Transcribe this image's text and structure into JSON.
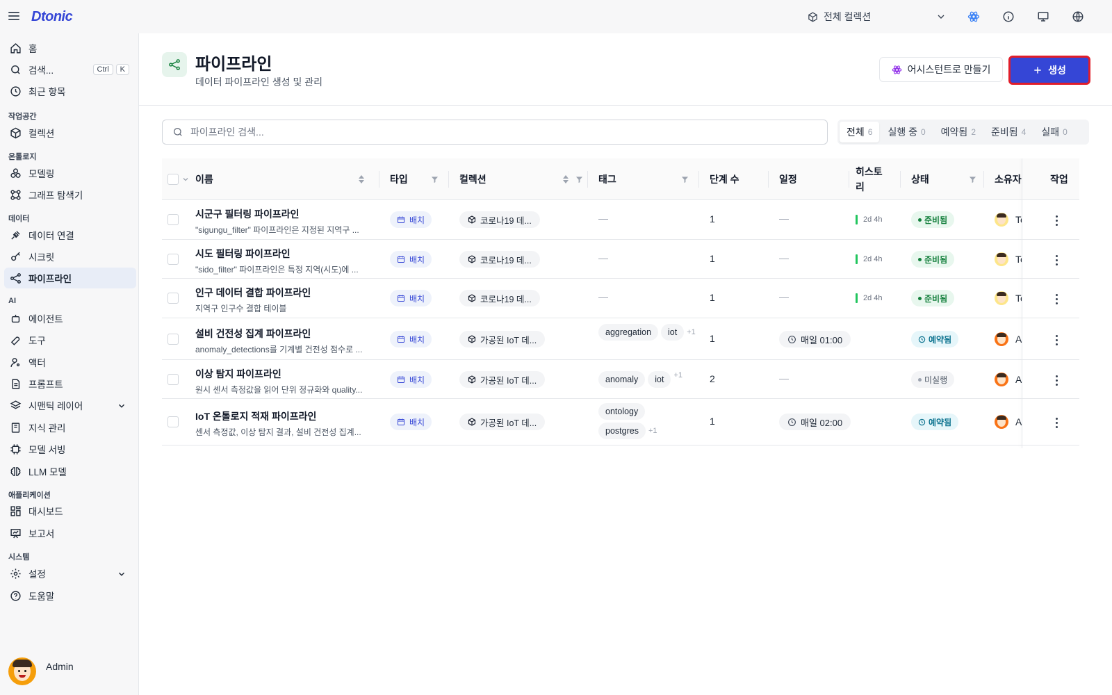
{
  "topbar": {
    "logo": "Dtonic",
    "collection_select": "전체 컬렉션"
  },
  "sidebar": {
    "home": "홈",
    "search": "검색...",
    "kbd_ctrl": "Ctrl",
    "kbd_k": "K",
    "recent": "최근 항목",
    "sections": {
      "workspace": "작업공간",
      "ontology": "온톨로지",
      "data": "데이터",
      "ai": "AI",
      "apps": "애플리케이션",
      "system": "시스템"
    },
    "items": {
      "collection": "컬렉션",
      "modeling": "모델링",
      "graph_explorer": "그래프 탐색기",
      "data_connect": "데이터 연결",
      "secret": "시크릿",
      "pipeline": "파이프라인",
      "agent": "에이전트",
      "tool": "도구",
      "actor": "액터",
      "prompt": "프롬프트",
      "semantic_layer": "시맨틱 레이어",
      "knowledge": "지식 관리",
      "model_serving": "모델 서빙",
      "llm_model": "LLM 모델",
      "dashboard": "대시보드",
      "report": "보고서",
      "settings": "설정",
      "help": "도움말"
    },
    "user_name": "Admin"
  },
  "page": {
    "title": "파이프라인",
    "subtitle": "데이터 파이프라인 생성 및 관리",
    "assist_button": "어시스턴트로 만들기",
    "create_button": "생성",
    "search_placeholder": "파이프라인 검색..."
  },
  "filters": [
    {
      "label": "전체",
      "count": "6"
    },
    {
      "label": "실행 중",
      "count": "0"
    },
    {
      "label": "예약됨",
      "count": "2"
    },
    {
      "label": "준비됨",
      "count": "4"
    },
    {
      "label": "실패",
      "count": "0"
    }
  ],
  "columns": {
    "name": "이름",
    "type": "타입",
    "collection": "컬렉션",
    "tags": "태그",
    "steps": "단계 수",
    "schedule": "일정",
    "history": "히스토리",
    "status": "상태",
    "owner": "소유자",
    "actions": "작업"
  },
  "rows": [
    {
      "name": "시군구 필터링 파이프라인",
      "desc": "\"sigungu_filter\" 파이프라인은 지정된 지역구 ...",
      "type": "배치",
      "collection": "코로나19 데...",
      "tags": [],
      "tag_more": "",
      "tags_empty": "—",
      "steps": "1",
      "schedule": "—",
      "history": "2d 4h",
      "status": "준비됨",
      "owner": "Te"
    },
    {
      "name": "시도 필터링 파이프라인",
      "desc": "\"sido_filter\" 파이프라인은 특정 지역(시도)에 ...",
      "type": "배치",
      "collection": "코로나19 데...",
      "tags": [],
      "tag_more": "",
      "tags_empty": "—",
      "steps": "1",
      "schedule": "—",
      "history": "2d 4h",
      "status": "준비됨",
      "owner": "Te"
    },
    {
      "name": "인구 데이터 결합 파이프라인",
      "desc": "지역구 인구수 결합 테이블",
      "type": "배치",
      "collection": "코로나19 데...",
      "tags": [],
      "tag_more": "",
      "tags_empty": "—",
      "steps": "1",
      "schedule": "—",
      "history": "2d 4h",
      "status": "준비됨",
      "owner": "Te"
    },
    {
      "name": "설비 건전성 집계 파이프라인",
      "desc": "anomaly_detections를 기계별 건전성 점수로 ...",
      "type": "배치",
      "collection": "가공된 IoT 데...",
      "tags": [
        "aggregation",
        "iot"
      ],
      "tag_more": "+1",
      "steps": "1",
      "schedule": "매일 01:00",
      "history": "",
      "status": "예약됨",
      "owner": "Ad"
    },
    {
      "name": "이상 탐지 파이프라인",
      "desc": "원시 센서 측정값을 읽어 단위 정규화와 quality...",
      "type": "배치",
      "collection": "가공된 IoT 데...",
      "tags": [
        "anomaly",
        "iot"
      ],
      "tag_more": "+1",
      "steps": "2",
      "schedule": "—",
      "history": "",
      "status": "미실행",
      "owner": "Ad"
    },
    {
      "name": "IoT 온톨로지 적재 파이프라인",
      "desc": "센서 측정값, 이상 탐지 결과, 설비 건전성 집계...",
      "type": "배치",
      "collection": "가공된 IoT 데...",
      "tags": [
        "ontology",
        "postgres"
      ],
      "tag_more": "+1",
      "steps": "1",
      "schedule": "매일 02:00",
      "history": "",
      "status": "예약됨",
      "owner": "Ad"
    }
  ],
  "colors": {
    "primary": "#3546d6",
    "highlight_outline": "#e11d2a",
    "ready": "#15803d",
    "scheduled": "#0e7490"
  }
}
